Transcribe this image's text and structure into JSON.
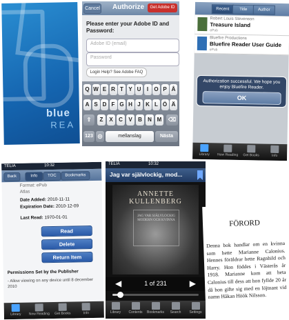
{
  "splash": {
    "logo_line1": "blue",
    "logo_line2": "REA"
  },
  "authorize": {
    "cancel": "Cancel",
    "title": "Authorize",
    "get_id": "Get Adobe ID",
    "prompt": "Please enter your Adobe ID and Password:",
    "id_placeholder": "Adobe ID (email)",
    "password_placeholder": "Password",
    "help": "Login Help? See Adobe FAQ",
    "keyboard": {
      "row1": [
        "Q",
        "W",
        "E",
        "R",
        "T",
        "Y",
        "U",
        "I",
        "O",
        "P",
        "Å"
      ],
      "row2": [
        "A",
        "S",
        "D",
        "F",
        "G",
        "H",
        "J",
        "K",
        "L",
        "Ö",
        "Ä"
      ],
      "row3": [
        "Z",
        "X",
        "C",
        "V",
        "B",
        "N",
        "M"
      ],
      "num": "123",
      "space": "mellanslag",
      "next": "Nästa"
    }
  },
  "library": {
    "tabs": [
      "Recent",
      "Title",
      "Author"
    ],
    "books": [
      {
        "author": "Robert Louis Stevenson",
        "title": "Treasure Island",
        "format": "ePub"
      },
      {
        "author": "Bluefire Productions",
        "title": "Bluefire Reader User Guide",
        "format": "ePub"
      }
    ],
    "alert_message": "Authorization successful. We hope you enjoy Bluefire Reader.",
    "alert_ok": "OK",
    "tabbar": [
      "Library",
      "Now Reading",
      "Get Books",
      "Info"
    ]
  },
  "bookinfo": {
    "carrier": "TELIA",
    "time": "10:32",
    "nav": [
      "Back",
      "Info",
      "TOC",
      "Bookmarks"
    ],
    "format_line": "Format: ePub",
    "publisher": "Atlas",
    "date_added_label": "Date Added:",
    "date_added": "2010-11-11",
    "expiration_label": "Expiration Date:",
    "expiration": "2010-12-09",
    "last_read_label": "Last Read:",
    "last_read": "1970-01-01",
    "read": "Read",
    "delete": "Delete",
    "return_item": "Return Item",
    "permissions_title": "Permissions Set by the Publisher",
    "permission_item": "- Allow viewing on any device until 8 december 2010",
    "tabbar": [
      "Library",
      "Now Reading",
      "Get Books",
      "Info"
    ]
  },
  "reader": {
    "carrier": "TELIA",
    "time": "10:32",
    "title": "Jag var självlockig, mod...",
    "author_cover": "ANNETTE KULLENBERG",
    "stamp_text": "JAG VAR SJÄLVLOCKIG MODERN OCH KVINNA",
    "page_label": "1 of 231",
    "progress": 0.06,
    "toolbar": [
      "Library",
      "Contents",
      "Bookmarks",
      "Search",
      "Settings"
    ]
  },
  "textpage": {
    "heading": "FÖRORD",
    "body": "Denna bok handlar om en kvinna som hette Marianne Calonius. Hennes föräldrar hette Ragnhild och Harry. Hon föddes i Västerås år 1918. Marianne kom att heta Calonius till dess att hon fyllde 20 år då hon gifte sig med en löjtnant vid namn Håkan Höök Nilsson."
  }
}
